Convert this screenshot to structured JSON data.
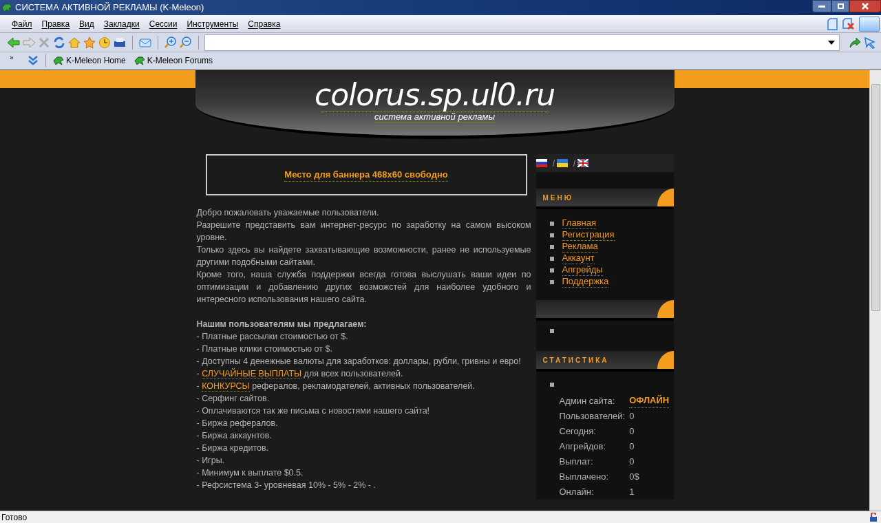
{
  "window": {
    "title": "СИСТЕМА АКТИВНОЙ РЕКЛАМЫ (K-Meleon)"
  },
  "menu": [
    "Файл",
    "Правка",
    "Вид",
    "Закладки",
    "Сессии",
    "Инструменты",
    "Справка"
  ],
  "toolbar_chevron": "»",
  "bookmarks": [
    "K-Meleon Home",
    "K-Meleon Forums"
  ],
  "page": {
    "site_title": "colorus.sp.ul0.ru",
    "site_subtitle": "система активной рекламы",
    "banner": "Место для баннера 468x60 свободно",
    "intro": [
      "Добро пожаловать уважаемые пользователи.",
      "Разрешите представить вам интернет-ресурс по заработку на самом высоком уровне.",
      "Только здесь вы найдете захватывающие возможности, ранее не используемые другими подобными сайтами.",
      "Кроме того, наша служба поддержки всегда готова выслушать ваши идеи по оптимизации и добавлению других возможстей для наиболее удобного и интересного использования нашего сайта."
    ],
    "offers_heading": "Нашим пользователям мы предлагаем:",
    "offers": [
      {
        "text": "- Платные рассылки стоимостью от $."
      },
      {
        "text": "- Платные клики стоимостью от $."
      },
      {
        "text": "- Доступны 4 денежные валюты для заработков: доллары, рубли, гривны и евро!"
      },
      {
        "prefix": "- ",
        "link": "СЛУЧАЙНЫЕ ВЫПЛАТЫ",
        "text": " для всех пользователей."
      },
      {
        "prefix": "- ",
        "link": "КОНКУРСЫ",
        "text": " рефералов, рекламодателей, активных пользователей."
      },
      {
        "text": "- Серфинг сайтов."
      },
      {
        "text": "- Оплачиваются так же письма с новостями нашего сайта!"
      },
      {
        "text": "- Биржа рефералов."
      },
      {
        "text": "- Биржа аккаунтов."
      },
      {
        "text": "- Биржа кредитов."
      },
      {
        "text": "- Игры."
      },
      {
        "text": "- Минимум к выплате $0.5."
      },
      {
        "text": "- Рефсистема 3- уровневая 10% - 5% - 2% - ."
      }
    ]
  },
  "sidebar": {
    "languages": [
      {
        "kind": "ru"
      },
      {
        "kind": "ua"
      },
      {
        "kind": "en"
      }
    ],
    "menu_title": "МЕНЮ",
    "menu_items": [
      "Главная",
      "Регистрация",
      "Реклама",
      "Аккаунт",
      "Апгрейды",
      "Поддержка"
    ],
    "stats_title": "СТАТИСТИКА",
    "stats": [
      {
        "label": "Админ сайта:",
        "value": "ОФЛАЙН",
        "kind": "link"
      },
      {
        "label": "Пользователей:",
        "value": "0",
        "kind": "text"
      },
      {
        "label": "Сегодня:",
        "value": "0",
        "kind": "text"
      },
      {
        "label": "Апгрейдов:",
        "value": "0",
        "kind": "text"
      },
      {
        "label": "Выплат:",
        "value": "0",
        "kind": "text"
      },
      {
        "label": "Выплачено:",
        "value": "0$",
        "kind": "text"
      },
      {
        "label": "Онлайн:",
        "value": "1",
        "kind": "text"
      }
    ]
  },
  "status_bar": {
    "text": "Готово"
  }
}
